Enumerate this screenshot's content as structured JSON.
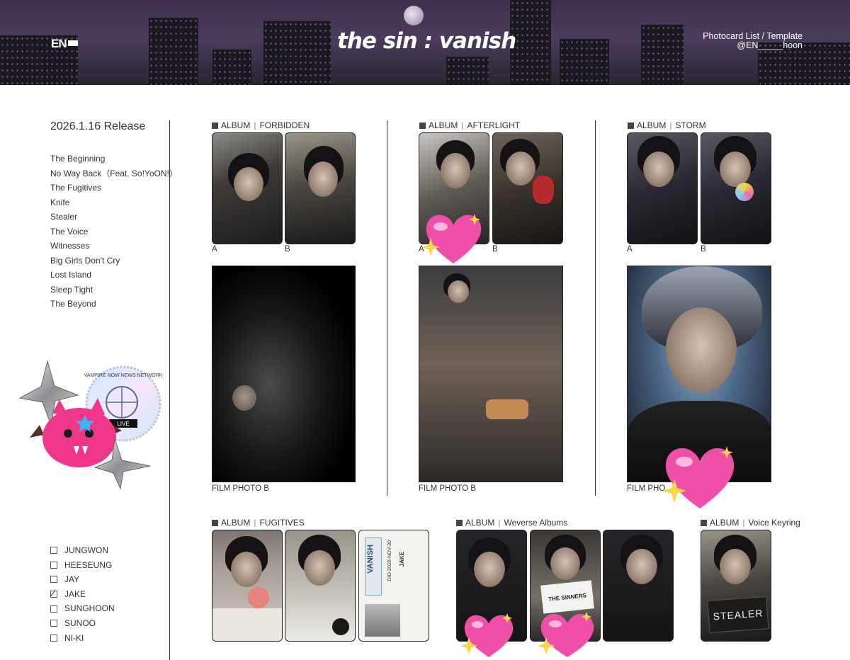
{
  "header": {
    "logo": "EN",
    "title": "the sin : vanish",
    "right_line1": "Photocard List / Template",
    "right_line2": "@EN_____hoon"
  },
  "release": "2026.1.16 Release",
  "tracks": [
    "The Beginning",
    "No Way Back（Feat. So!YoON!）",
    "The Fugitives",
    "Knife",
    "Stealer",
    "The Voice",
    "Witnesses",
    "Big Girls Don't Cry",
    "Lost Island",
    "Sleep Tight",
    "The Beyond"
  ],
  "members": [
    {
      "name": "JUNGWON",
      "checked": false
    },
    {
      "name": "HEESEUNG",
      "checked": false
    },
    {
      "name": "JAY",
      "checked": false
    },
    {
      "name": "JAKE",
      "checked": true
    },
    {
      "name": "SUNGHOON",
      "checked": false
    },
    {
      "name": "SUNOO",
      "checked": false
    },
    {
      "name": "NI-KI",
      "checked": false
    }
  ],
  "sections": {
    "forbidden": {
      "prefix": "ALBUM",
      "name": "FORBIDDEN",
      "card_a": "A",
      "card_b": "B",
      "film": "FILM PHOTO B"
    },
    "afterlight": {
      "prefix": "ALBUM",
      "name": "AFTERLIGHT",
      "card_a": "A",
      "card_b": "B",
      "film": "FILM PHOTO B"
    },
    "storm": {
      "prefix": "ALBUM",
      "name": "STORM",
      "card_a": "A",
      "card_b": "B",
      "film": "FILM PHO"
    },
    "fugitives": {
      "prefix": "ALBUM",
      "name": "FUGITIVES"
    },
    "weverse": {
      "prefix": "ALBUM",
      "name": "Weverse Albums"
    },
    "keyring": {
      "prefix": "ALBUM",
      "name": "Voice Keyring"
    }
  },
  "id_card": {
    "title": "VANISH",
    "name": "JAKE",
    "code": "DID-2026-NOV-30"
  },
  "sinners_card": "THE SINNERS",
  "keyring_sign": "STEALER",
  "badge_text": "VAMPIRE NOW NEWS NETWORK",
  "badge_live": "LIVE",
  "colors": {
    "header_bg": "#3b2f4d",
    "heart": "#f04fa8",
    "sparkle": "#f7d64a",
    "plush": "#f0368a"
  }
}
